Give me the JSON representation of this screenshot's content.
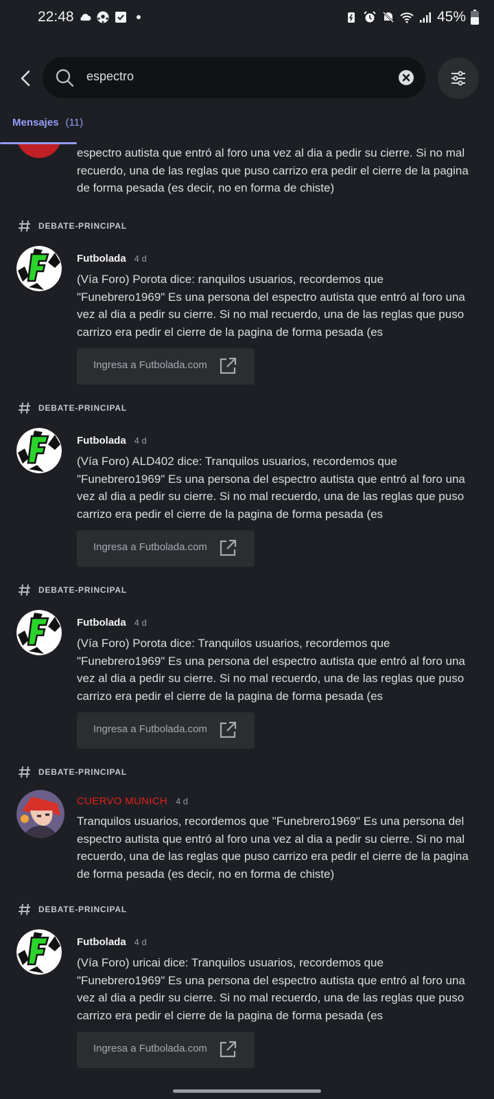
{
  "status": {
    "time": "22:48",
    "battery": "45%"
  },
  "search": {
    "query": "espectro"
  },
  "tabs": [
    {
      "label": "Mensajes",
      "count": "(11)"
    }
  ],
  "partial_result": {
    "text": "espectro autista que entró al foro una vez al dia a pedir su cierre.  Si no mal recuerdo, una de las reglas que puso carrizo era pedir el cierre de la pagina de forma pesada (es decir, no en forma de chiste)"
  },
  "results": [
    {
      "channel": "DEBATE-PRINCIPAL",
      "author": "Futbolada",
      "time": "4 d",
      "text": "(Vía Foro) Porota dice: ranquilos usuarios, recordemos que \"Funebrero1969\" Es una persona del espectro autista que entró al foro una vez al dia a pedir su cierre.  Si no mal recuerdo, una de las reglas que puso carrizo era pedir el cierre de la pagina de forma pesada (es",
      "embed": "Ingresa a Futbolada.com"
    },
    {
      "channel": "DEBATE-PRINCIPAL",
      "author": "Futbolada",
      "time": "4 d",
      "text": "(Vía Foro) ALD402 dice: Tranquilos usuarios, recordemos que \"Funebrero1969\" Es una persona del espectro autista que entró al foro una vez al dia a pedir su cierre.  Si no mal recuerdo, una de las reglas que puso carrizo era pedir el cierre de la pagina de forma pesada (es",
      "embed": "Ingresa a Futbolada.com"
    },
    {
      "channel": "DEBATE-PRINCIPAL",
      "author": "Futbolada",
      "time": "4 d",
      "text": "(Vía Foro) Porota dice: Tranquilos usuarios, recordemos que \"Funebrero1969\" Es una persona del espectro autista que entró al foro una vez al dia a pedir su cierre.  Si no mal recuerdo, una de las reglas que puso carrizo era pedir el cierre de la pagina de forma pesada (es",
      "embed": "Ingresa a Futbolada.com"
    },
    {
      "channel": "DEBATE-PRINCIPAL",
      "author": "CUERVO MUNICH",
      "time": "4 d",
      "text": "Tranquilos usuarios, recordemos que \"Funebrero1969\" Es una persona del espectro autista que entró al foro una vez al dia a pedir su cierre.  Si no mal recuerdo, una de las reglas que puso carrizo era pedir el cierre de la pagina de forma pesada (es decir, no en forma de chiste)"
    },
    {
      "channel": "DEBATE-PRINCIPAL",
      "author": "Futbolada",
      "time": "4 d",
      "text": "(Vía Foro) uricai dice: Tranquilos usuarios, recordemos que \"Funebrero1969\" Es una persona del espectro autista que entró al foro una vez al dia a pedir su cierre.  Si no mal recuerdo, una de las reglas que puso carrizo era pedir el cierre de la pagina de forma pesada (es",
      "embed": "Ingresa a Futbolada.com"
    }
  ],
  "colors": {
    "background": "#1e1f24",
    "accent": "#949cf7",
    "author_red": "#e0211a",
    "embed_bg": "#2b2d31"
  }
}
